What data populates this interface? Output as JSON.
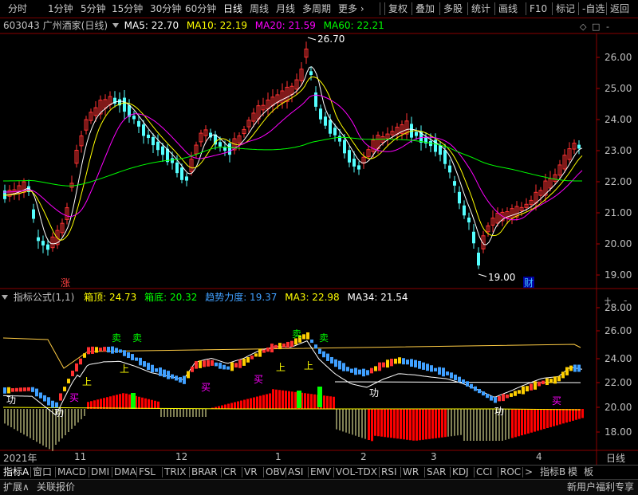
{
  "toolbar": {
    "periods": [
      "分时",
      "1分钟",
      "5分钟",
      "15分钟",
      "30分钟",
      "60分钟",
      "日线",
      "周线",
      "月线",
      "多周期",
      "更多"
    ],
    "active": "日线",
    "right": [
      "复权",
      "叠加",
      "多股",
      "统计",
      "画线",
      "F10",
      "标记",
      "-自选",
      "返回"
    ]
  },
  "stock": {
    "code": "603043",
    "name": "广州酒家(日线)",
    "ma5_label": "MA5: 22.70",
    "ma10_label": "MA10: 22.19",
    "ma20_label": "MA20: 21.59",
    "ma60_label": "MA60: 22.21",
    "high_label": "26.70",
    "low_label": "19.00",
    "marker_zhang": "涨",
    "marker_cai": "财"
  },
  "indicator": {
    "name": "指标公式(1,1)",
    "box_top_label": "箱顶: 24.73",
    "box_bottom_label": "箱底: 20.32",
    "trend_label": "趋势力度: 19.37",
    "ma3_label": "MA3: 22.98",
    "ma34_label": "MA34: 21.54",
    "sell": "卖",
    "buy": "买",
    "up": "上",
    "gong": "功"
  },
  "price_axis": [
    "26.00",
    "25.00",
    "24.00",
    "23.00",
    "22.00",
    "21.00",
    "20.00",
    "19.00"
  ],
  "ind_axis": [
    "28.00",
    "26.00",
    "24.00",
    "22.00",
    "20.00",
    "18.00"
  ],
  "date_axis": {
    "year": "2021年",
    "m11": "11",
    "m12": "12",
    "m1": "1",
    "m2": "2",
    "m3": "3",
    "m4": "4",
    "period": "日线"
  },
  "tabs": [
    "指标A",
    "窗口",
    "MACD",
    "DMI",
    "DMA",
    "FSL",
    "TRIX",
    "BRAR",
    "CR",
    "VR",
    "OBV",
    "ASI",
    "EMV",
    "VOL-TDX",
    "RSI",
    "WR",
    "SAR",
    "KDJ",
    "CCI",
    "ROC",
    ">",
    "指标B",
    "模",
    "板"
  ],
  "status": {
    "expand": "扩展∧",
    "linked": "关联报价",
    "promo": "新用户福利专享"
  },
  "colors": {
    "up": "#ff3232",
    "down": "#54ffff",
    "ma5": "#ffffff",
    "ma10": "#ffff00",
    "ma20": "#ff00ff",
    "ma60": "#00ff00",
    "axis": "#b00000"
  }
}
